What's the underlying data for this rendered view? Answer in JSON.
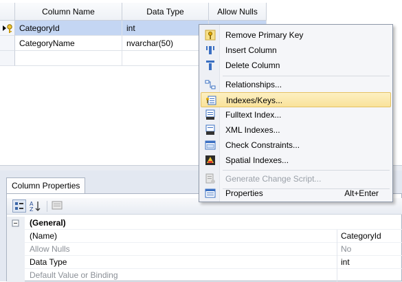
{
  "grid": {
    "headers": [
      "Column Name",
      "Data Type",
      "Allow Nulls"
    ],
    "rows": [
      {
        "name": "CategoryId",
        "type": "int"
      },
      {
        "name": "CategoryName",
        "type": "nvarchar(50)"
      }
    ]
  },
  "menu": {
    "items": [
      {
        "label": "Remove Primary Key",
        "icon": "key-icon"
      },
      {
        "label": "Insert Column",
        "icon": "insert-column-icon"
      },
      {
        "label": "Delete Column",
        "icon": "delete-column-icon"
      },
      {
        "label": "Relationships...",
        "icon": "relationships-icon"
      },
      {
        "label": "Indexes/Keys...",
        "icon": "indexes-keys-icon"
      },
      {
        "label": "Fulltext Index...",
        "icon": "fulltext-index-icon"
      },
      {
        "label": "XML Indexes...",
        "icon": "xml-indexes-icon"
      },
      {
        "label": "Check Constraints...",
        "icon": "check-constraints-icon"
      },
      {
        "label": "Spatial Indexes...",
        "icon": "spatial-indexes-icon"
      },
      {
        "label": "Generate Change Script...",
        "icon": "generate-script-icon"
      },
      {
        "label": "Properties",
        "icon": "properties-icon",
        "shortcut": "Alt+Enter"
      }
    ]
  },
  "properties": {
    "tab_label": "Column Properties",
    "section": "(General)",
    "rows": [
      {
        "name": "(Name)",
        "value": "CategoryId"
      },
      {
        "name": "Allow Nulls",
        "value": "No"
      },
      {
        "name": "Data Type",
        "value": "int"
      },
      {
        "name": "Default Value or Binding",
        "value": ""
      }
    ]
  },
  "colors": {
    "selection": "#c4d6f3",
    "menu_highlight": "#f9e29a"
  }
}
